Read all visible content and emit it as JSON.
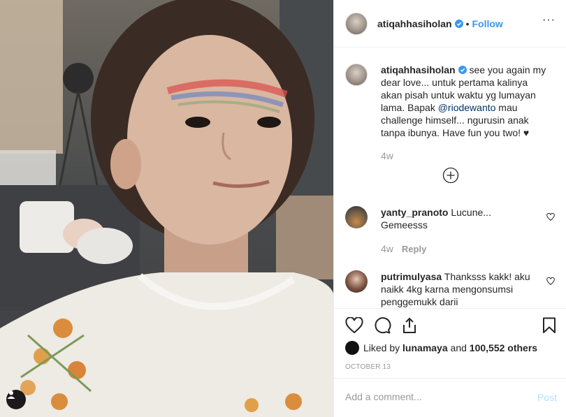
{
  "header": {
    "username": "atiqahhasiholan",
    "separator": "•",
    "follow_label": "Follow",
    "more_label": "···"
  },
  "caption": {
    "username": "atiqahhasiholan",
    "text_before": "see you again my dear love... untuk pertama kalinya akan pisah untuk waktu yg lumayan lama. Bapak ",
    "mention": "@riodewanto",
    "text_after": " mau challenge himself... ngurusin anak tanpa ibunya. Have fun you two! ♥",
    "time": "4w"
  },
  "comments": [
    {
      "username": "yanty_pranoto",
      "text": "Lucune... Gemeesss",
      "time": "4w",
      "reply_label": "Reply"
    },
    {
      "username": "putrimulyasa",
      "text": "Thanksss kakk! aku naikk 4kg karna mengonsumsi penggemukk darii"
    }
  ],
  "likes": {
    "prefix": "Liked by",
    "user": "lunamaya",
    "joiner": "and",
    "others": "100,552 others"
  },
  "date": "OCTOBER 13",
  "add_comment": {
    "placeholder": "Add a comment...",
    "post_label": "Post"
  },
  "colors": {
    "link": "#3897f0",
    "verified": "#3897f0",
    "muted": "#999999",
    "post_disabled": "#b2dffc"
  }
}
